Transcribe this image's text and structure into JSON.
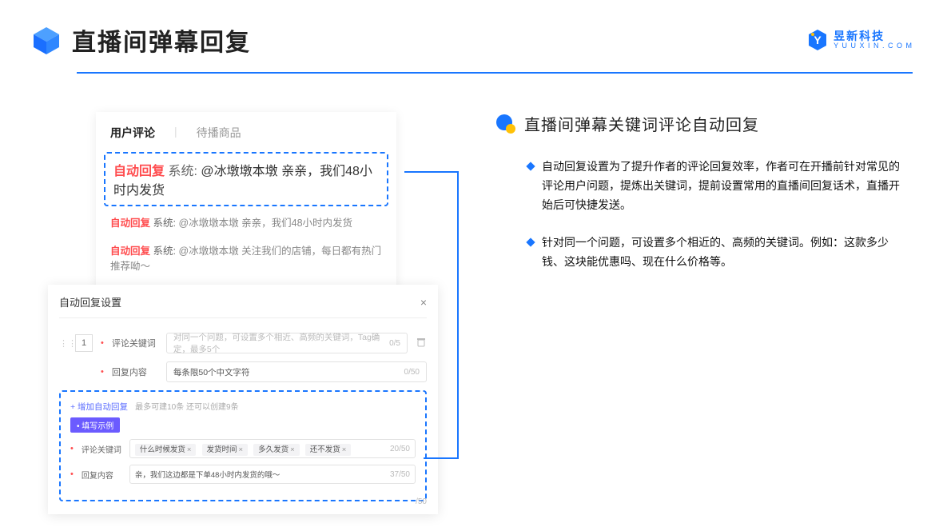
{
  "header": {
    "title": "直播间弹幕回复",
    "brand_cn": "昱新科技",
    "brand_en": "Y U U X I N . C O M"
  },
  "comment_panel": {
    "tabs": {
      "active": "用户评论",
      "inactive": "待播商品"
    },
    "label_autoreply": "自动回复",
    "label_system": "系统:",
    "rows": [
      "@冰墩墩本墩 亲亲，我们48小时内发货",
      "@冰墩墩本墩 亲亲，我们48小时内发货",
      "@冰墩墩本墩 关注我们的店铺，每日都有热门推荐呦～"
    ]
  },
  "settings": {
    "title": "自动回复设置",
    "close": "×",
    "row_index": "1",
    "keyword_label": "评论关键词",
    "keyword_placeholder": "对同一个问题，可设置多个相近、高频的关键词，Tag确定，最多5个",
    "keyword_count": "0/5",
    "content_label": "回复内容",
    "content_placeholder": "每条限50个中文字符",
    "content_count": "0/50",
    "add_text": "+ 增加自动回复",
    "add_hint": "最多可建10条 还可以创建9条",
    "example_badge": "• 填写示例",
    "ex_keyword_label": "评论关键词",
    "ex_tags": [
      "什么时候发货",
      "发货时间",
      "多久发货",
      "还不发货"
    ],
    "ex_keyword_count": "20/50",
    "ex_content_label": "回复内容",
    "ex_content_value": "亲，我们这边都是下单48小时内发货的哦～",
    "ex_content_count": "37/50",
    "bottom_count": "/50"
  },
  "right": {
    "section_title": "直播间弹幕关键词评论自动回复",
    "bullets": [
      "自动回复设置为了提升作者的评论回复效率，作者可在开播前针对常见的评论用户问题，提炼出关键词，提前设置常用的直播间回复话术，直播开始后可快捷发送。",
      "针对同一个问题，可设置多个相近的、高频的关键词。例如：这款多少钱、这块能优惠吗、现在什么价格等。"
    ]
  }
}
